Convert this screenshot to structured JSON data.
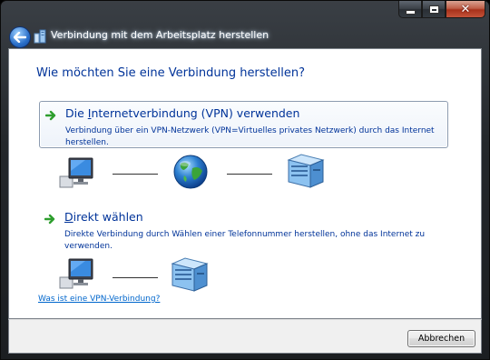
{
  "window": {
    "title": "Verbindung mit dem Arbeitsplatz herstellen"
  },
  "content": {
    "heading": "Wie möchten Sie eine Verbindung herstellen?",
    "options": [
      {
        "title_pre": "Die ",
        "title_access": "I",
        "title_post": "nternetverbindung (VPN) verwenden",
        "description": "Verbindung über ein VPN-Netzwerk (VPN=Virtuelles privates Netzwerk) durch das Internet herstellen."
      },
      {
        "title_pre": "",
        "title_access": "D",
        "title_post": "irekt wählen",
        "description": "Direkte Verbindung durch Wählen einer Telefonnummer herstellen, ohne das Internet zu verwenden."
      }
    ],
    "help_link": "Was ist eine VPN-Verbindung?"
  },
  "footer": {
    "cancel_label": "Abbrechen"
  },
  "colors": {
    "heading_blue": "#003399",
    "link_blue": "#0066cc",
    "arrow_green": "#2e9e2e"
  }
}
